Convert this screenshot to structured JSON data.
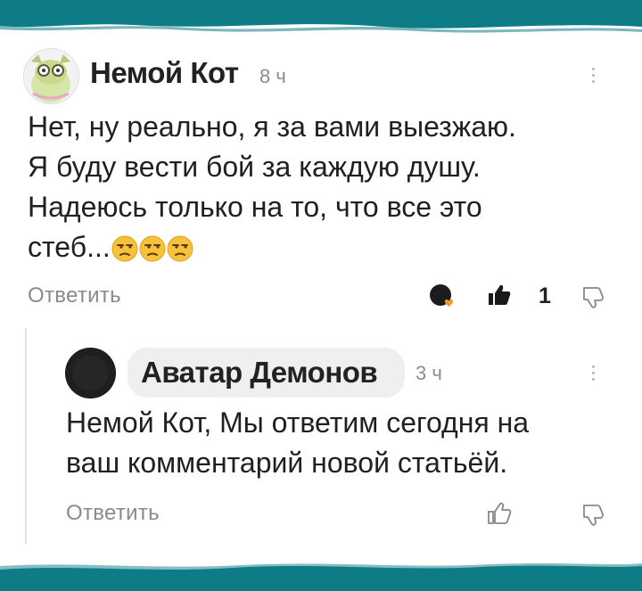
{
  "comment": {
    "author": "Немой Кот",
    "time": "8 ч",
    "text_lines": [
      "Нет, ну реально, я за вами выезжаю.",
      "Я буду вести бой за каждую душу.",
      "Надеюсь только на то, что все это",
      "стеб..."
    ],
    "emoji": [
      "unamused-face-icon",
      "unamused-face-icon",
      "unamused-face-icon"
    ],
    "reply_label": "Ответить",
    "likes": "1"
  },
  "reply": {
    "author": "Аватар Демонов",
    "time": "3 ч",
    "text_lines": [
      "Немой Кот, Мы ответим сегодня на",
      "ваш комментарий новой статьёй."
    ],
    "reply_label": "Ответить"
  },
  "colors": {
    "band": "#0e7c86",
    "emoji": "#f7c23b",
    "text": "#202020",
    "muted": "#8a8a8a"
  }
}
